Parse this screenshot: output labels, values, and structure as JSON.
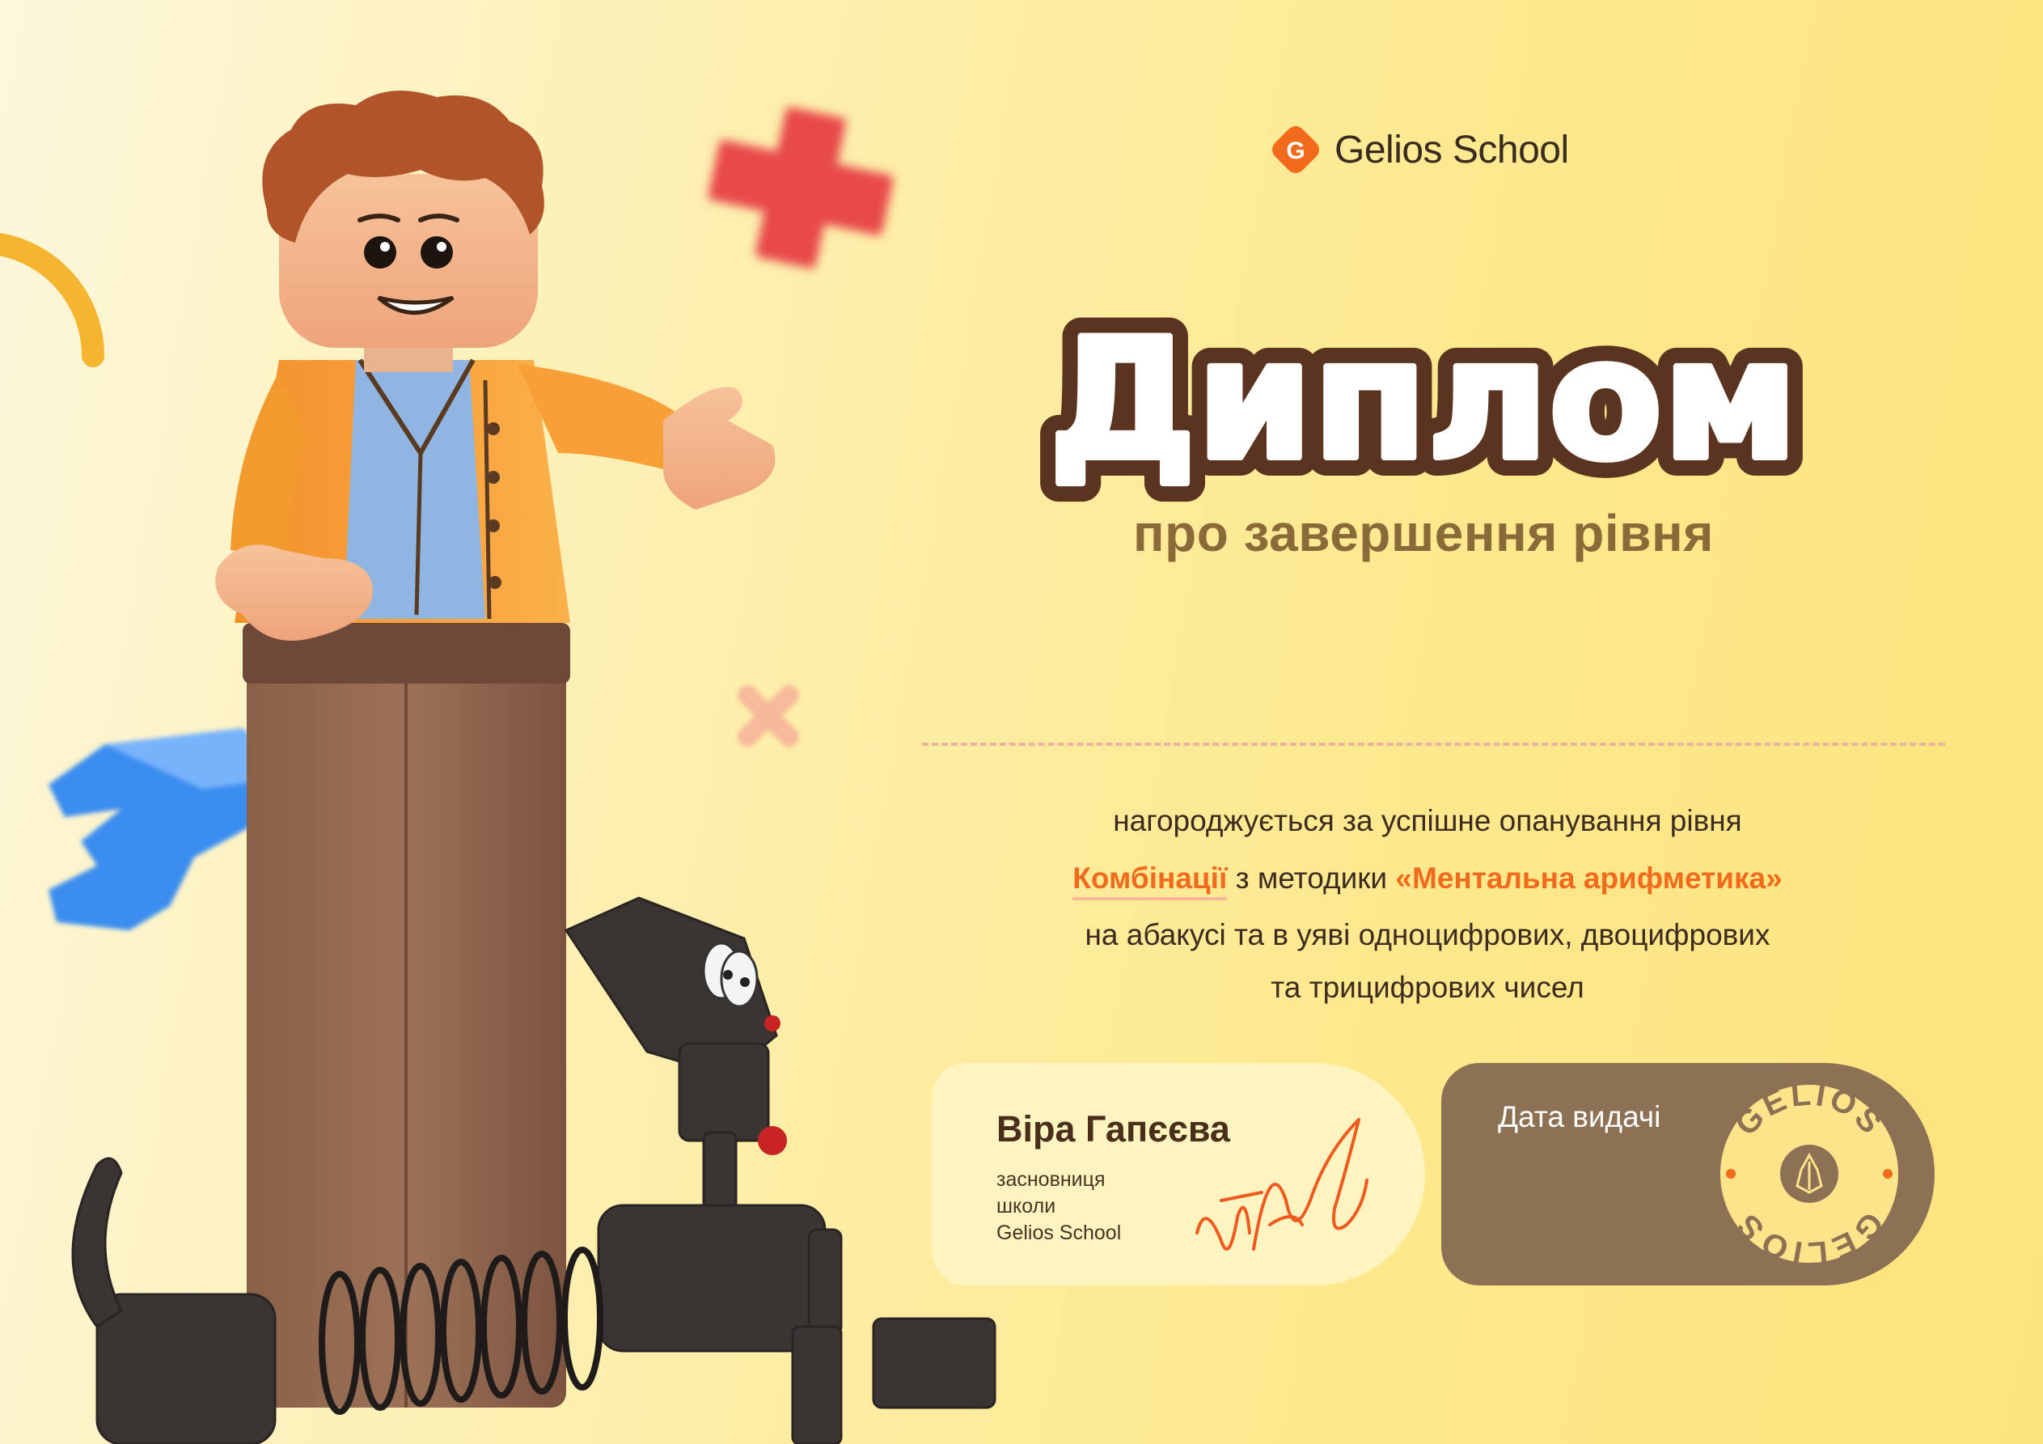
{
  "brand": {
    "name": "Gelios School",
    "logo_letter": "G"
  },
  "title": "Диплом",
  "subtitle": "про завершення рівня",
  "award": {
    "line1": "нагороджується за успішне опанування рівня",
    "level_name": "Комбінації",
    "connector": "з методики",
    "method_name": "«Ментальна арифметика»",
    "line3": "на абакусі та в уяві одноцифрових, двоцифрових",
    "line4": "та трицифрових чисел"
  },
  "signer": {
    "name": "Віра Гапєєва",
    "role": "засновниця\nшколи\nGelios School"
  },
  "date": {
    "label": "Дата видачі"
  },
  "stamp": {
    "text": "GELIOS"
  },
  "colors": {
    "accent": "#f26a1b",
    "brown": "#8d7155",
    "title_outline": "#5a3420",
    "background": "#fde98f"
  }
}
